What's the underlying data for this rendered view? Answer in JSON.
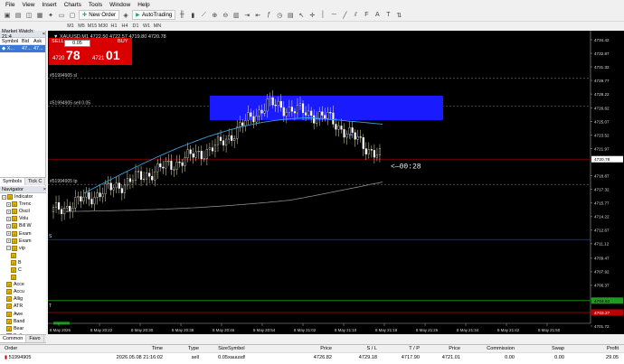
{
  "menu": [
    "File",
    "View",
    "Insert",
    "Charts",
    "Tools",
    "Window",
    "Help"
  ],
  "toolbar": {
    "new_order": "New Order",
    "auto_trading": "AutoTrading"
  },
  "timeframes": [
    "M1",
    "M5",
    "M15",
    "M30",
    "H1",
    "H4",
    "D1",
    "W1",
    "MN"
  ],
  "market_watch": {
    "title": "Market Watch: 21:4",
    "headers": [
      "Symbol",
      "Bid",
      "Ask"
    ],
    "row": [
      "X...",
      "47...",
      "47..."
    ],
    "tabs": [
      "Symbols",
      "Tick C"
    ]
  },
  "navigator": {
    "title": "Navigator",
    "items": [
      {
        "ex": "−",
        "label": "Indicator",
        "indent": 0
      },
      {
        "ex": "+",
        "label": "Trenc",
        "indent": 1
      },
      {
        "ex": "+",
        "label": "Oscil",
        "indent": 1
      },
      {
        "ex": "+",
        "label": "Volu",
        "indent": 1
      },
      {
        "ex": "+",
        "label": "Bill W",
        "indent": 1
      },
      {
        "ex": "+",
        "label": "Exam",
        "indent": 1
      },
      {
        "ex": "+",
        "label": "Exam",
        "indent": 1
      },
      {
        "ex": "−",
        "label": "vip",
        "indent": 1
      },
      {
        "ex": "",
        "label": "",
        "indent": 2
      },
      {
        "ex": "",
        "label": "B",
        "indent": 2
      },
      {
        "ex": "",
        "label": "C",
        "indent": 2
      },
      {
        "ex": "",
        "label": "",
        "indent": 2
      },
      {
        "ex": "",
        "label": "Acce",
        "indent": 1
      },
      {
        "ex": "",
        "label": "Accu",
        "indent": 1
      },
      {
        "ex": "",
        "label": "Allig",
        "indent": 1
      },
      {
        "ex": "",
        "label": "ATR",
        "indent": 1
      },
      {
        "ex": "",
        "label": "Awe",
        "indent": 1
      },
      {
        "ex": "",
        "label": "Band",
        "indent": 1
      },
      {
        "ex": "",
        "label": "Bear",
        "indent": 1
      },
      {
        "ex": "",
        "label": "Bulls",
        "indent": 1
      },
      {
        "ex": "",
        "label": "CCI",
        "indent": 1
      }
    ]
  },
  "chart": {
    "header": "▼ XAUUSD,M1  4722.50 4722.57 4719.80 4720.78",
    "sell_label": "SELL",
    "buy_label": "BUY",
    "lot": "0.05",
    "bid_small": "4720",
    "bid_big": "78",
    "ask_small": "4721",
    "ask_big": "01",
    "line_sl": "#51994905 sl",
    "line_sell": "#51994905 sell 0.05",
    "line_tp": "#51994905 tp",
    "countdown": "<—00:28",
    "level_s": "S",
    "level_t": "T",
    "price_tags": {
      "current": "4720.78",
      "green": "4704.63",
      "red": "4703.27"
    },
    "price_ticks": [
      "4734.42",
      "4732.87",
      "4731.32",
      "4729.77",
      "4728.22",
      "4726.62",
      "4725.07",
      "4723.52",
      "4721.97",
      "4718.87",
      "4717.32",
      "4715.77",
      "4714.22",
      "4712.67",
      "4711.12",
      "4709.47",
      "4707.92",
      "4706.37",
      "4704.82",
      "4701.72"
    ],
    "time_ticks": [
      "8 May 2026",
      "8 May 20:22",
      "8 May 20:30",
      "8 May 20:38",
      "8 May 20:46",
      "8 May 20:54",
      "8 May 21:02",
      "8 May 21:10",
      "8 May 21:18",
      "8 May 21:26",
      "8 May 21:34",
      "8 May 21:42",
      "8 May 21:50"
    ]
  },
  "orders": {
    "headers": [
      "Order",
      "Time",
      "Type",
      "Size",
      "Symbol",
      "Price",
      "S / L",
      "T / P",
      "Price",
      "Commission",
      "Swap",
      "Profit"
    ],
    "row": [
      "51994905",
      "2026.05.08 21:16:02",
      "sell",
      "0.05",
      "xauusd!",
      "4726.82",
      "4729.18",
      "4717.90",
      "4721.01",
      "0.00",
      "0.00",
      "29.05"
    ],
    "tabs": [
      "Common",
      "Favo"
    ]
  },
  "colors": {
    "sell": "#d90000",
    "zone": "#1a1aff",
    "ma_fast": "#3aa0e0",
    "ma_slow": "#8c8c8c",
    "bull": "#ffffff",
    "bear": "#ffffff",
    "wick": "#e8e6b0"
  }
}
